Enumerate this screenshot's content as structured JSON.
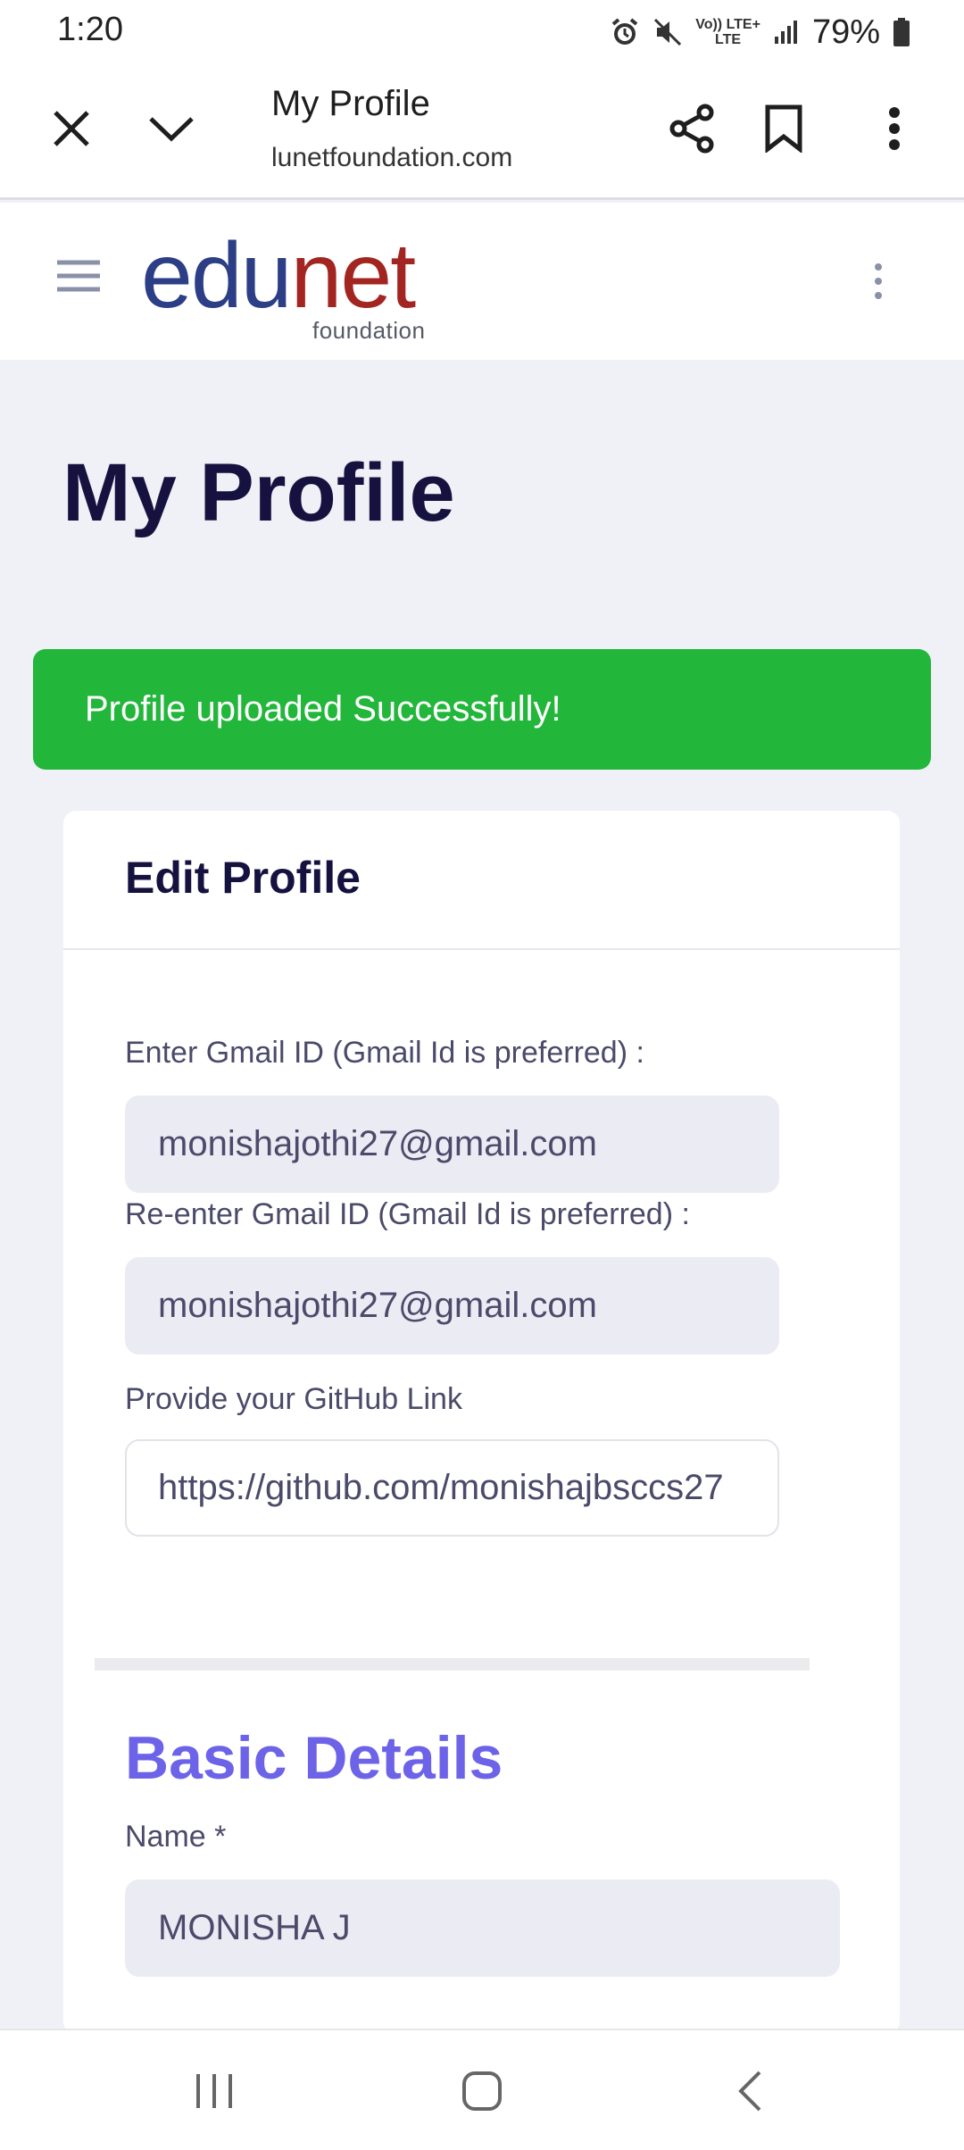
{
  "status_bar": {
    "time": "1:20",
    "network_top": "Vo)) LTE+",
    "network_bottom": "LTE",
    "battery": "79%",
    "icons": [
      "alarm-icon",
      "mute-icon",
      "signal-icon",
      "battery-icon"
    ]
  },
  "browser": {
    "title": "My Profile",
    "url": "lunetfoundation.com",
    "icons": [
      "close-icon",
      "chevron-down-icon",
      "share-icon",
      "bookmark-icon",
      "more-vert-icon"
    ]
  },
  "site": {
    "logo_part1": "edu",
    "logo_part2": "net",
    "logo_sub": "foundation",
    "icons": [
      "hamburger-icon",
      "more-vert-icon"
    ]
  },
  "page": {
    "title": "My Profile"
  },
  "alert": {
    "message": "Profile uploaded Successfully!",
    "color": "#22b63a"
  },
  "edit_profile": {
    "title": "Edit Profile",
    "gmail_label": "Enter Gmail ID (Gmail Id is preferred) :",
    "gmail_value": "monishajothi27@gmail.com",
    "regmail_label": "Re-enter Gmail ID (Gmail Id is preferred) :",
    "regmail_value": "monishajothi27@gmail.com",
    "github_label": "Provide your GitHub Link",
    "github_value": "https://github.com/monishajbsccs27"
  },
  "basic_details": {
    "title": "Basic Details",
    "name_label": "Name *",
    "name_value": "MONISHA J",
    "accent": "#6c63e8"
  },
  "nav": {
    "icons": [
      "recents-icon",
      "home-icon",
      "back-icon"
    ]
  }
}
